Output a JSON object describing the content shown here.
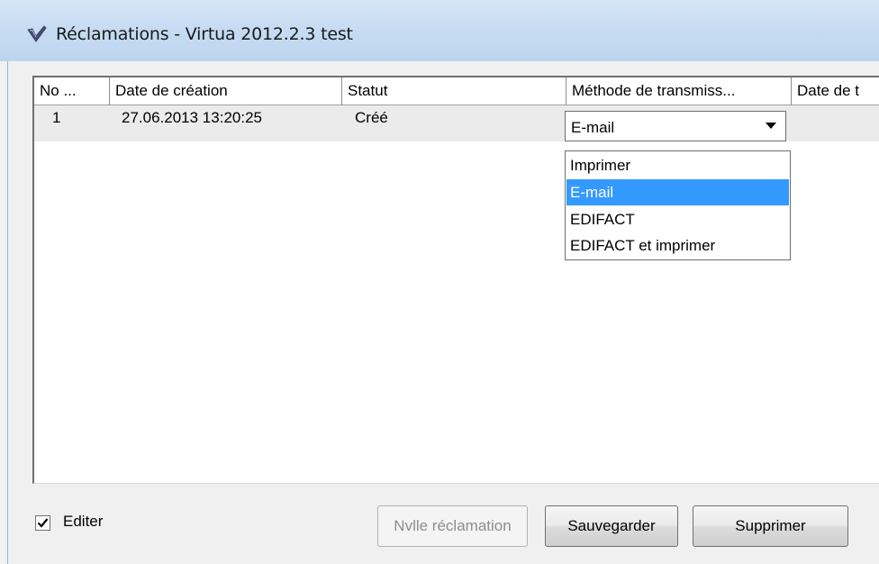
{
  "window": {
    "title": "Réclamations - Virtua 2012.2.3 test",
    "icon": "virtua-check-logo-icon"
  },
  "grid": {
    "columns": [
      "No ...",
      "Date de création",
      "Statut",
      "Méthode de transmiss...",
      "Date de t"
    ],
    "rows": [
      {
        "no": "1",
        "date_creation": "27.06.2013 13:20:25",
        "statut": "Créé",
        "methode": "E-mail"
      }
    ]
  },
  "dropdown": {
    "selected": "E-mail",
    "options": [
      "Imprimer",
      "E-mail",
      "EDIFACT",
      "EDIFACT et imprimer"
    ],
    "highlight_color": "#3399ff"
  },
  "footer": {
    "edit_checkbox_label": "Editer",
    "edit_checked": true,
    "buttons": {
      "new": "Nvlle réclamation",
      "save": "Sauvegarder",
      "delete": "Supprimer"
    }
  }
}
